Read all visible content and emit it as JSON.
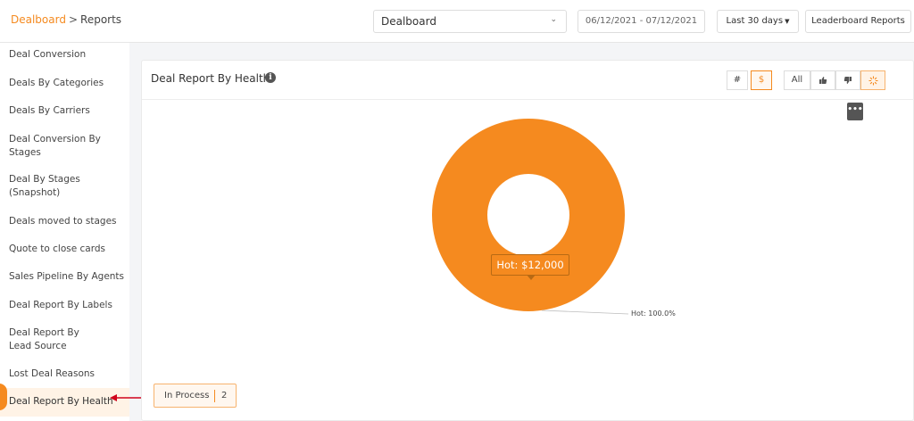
{
  "breadcrumb": {
    "root": "Dealboard",
    "separator": ">",
    "current": "Reports"
  },
  "toolbar": {
    "board_select": "Dealboard",
    "date_range": "06/12/2021 - 07/12/2021",
    "period": "Last 30 days",
    "leaderboard": "Leaderboard Reports"
  },
  "sidebar": {
    "items": [
      {
        "label": "Deal Conversion"
      },
      {
        "label": "Deals By Categories"
      },
      {
        "label": "Deals By Carriers"
      },
      {
        "label": "Deal Conversion By Stages"
      },
      {
        "label": "Deal By Stages (Snapshot)"
      },
      {
        "label": "Deals moved to stages"
      },
      {
        "label": "Quote to close cards"
      },
      {
        "label": "Sales Pipeline By Agents"
      },
      {
        "label": "Deal Report By Labels"
      },
      {
        "label": "Deal Report By Lead Source"
      },
      {
        "label": "Lost Deal Reasons"
      },
      {
        "label": "Deal Report By Health"
      }
    ],
    "active_index": 11
  },
  "card": {
    "title": "Deal Report By Health",
    "buttons": {
      "count": "#",
      "amount": "$",
      "all": "All"
    },
    "menu": "•••"
  },
  "chart_data": {
    "type": "pie",
    "variant": "donut",
    "slices": [
      {
        "name": "Hot",
        "value": 12000,
        "percent": 100.0,
        "color": "#f58a1f"
      }
    ],
    "tooltip": "Hot: $12,000",
    "slice_label": "Hot: 100.0%"
  },
  "status": {
    "label": "In Process",
    "count": "2"
  },
  "colors": {
    "accent": "#f58a1f",
    "active_bg": "#fff3e6",
    "arrow": "#d0021b"
  }
}
